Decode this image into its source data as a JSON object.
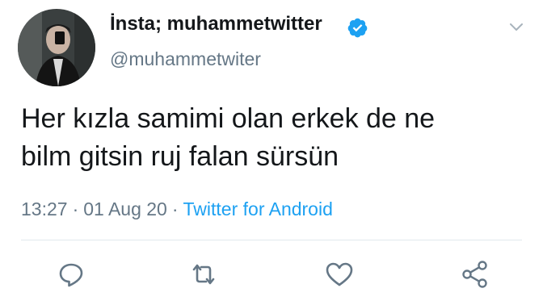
{
  "tweet": {
    "display_name": "İnsta; muhammetwitter",
    "handle": "@muhammetwiter",
    "verified": true,
    "text_lines": [
      "Her kızla samimi olan erkek de ne",
      "bilm gitsin ruj falan sürsün"
    ],
    "time": "13:27",
    "date": "01 Aug 20",
    "separator": "·",
    "source": "Twitter for Android"
  },
  "icons": {
    "avatar": "profile-photo",
    "verified": "verified-badge-icon",
    "caret": "chevron-down-icon",
    "reply": "reply-icon",
    "retweet": "retweet-icon",
    "like": "heart-icon",
    "share": "share-icon"
  },
  "colors": {
    "text": "#14171a",
    "secondary": "#657786",
    "link": "#1da1f2",
    "verified": "#1da1f2",
    "divider": "#e1e8ed"
  }
}
